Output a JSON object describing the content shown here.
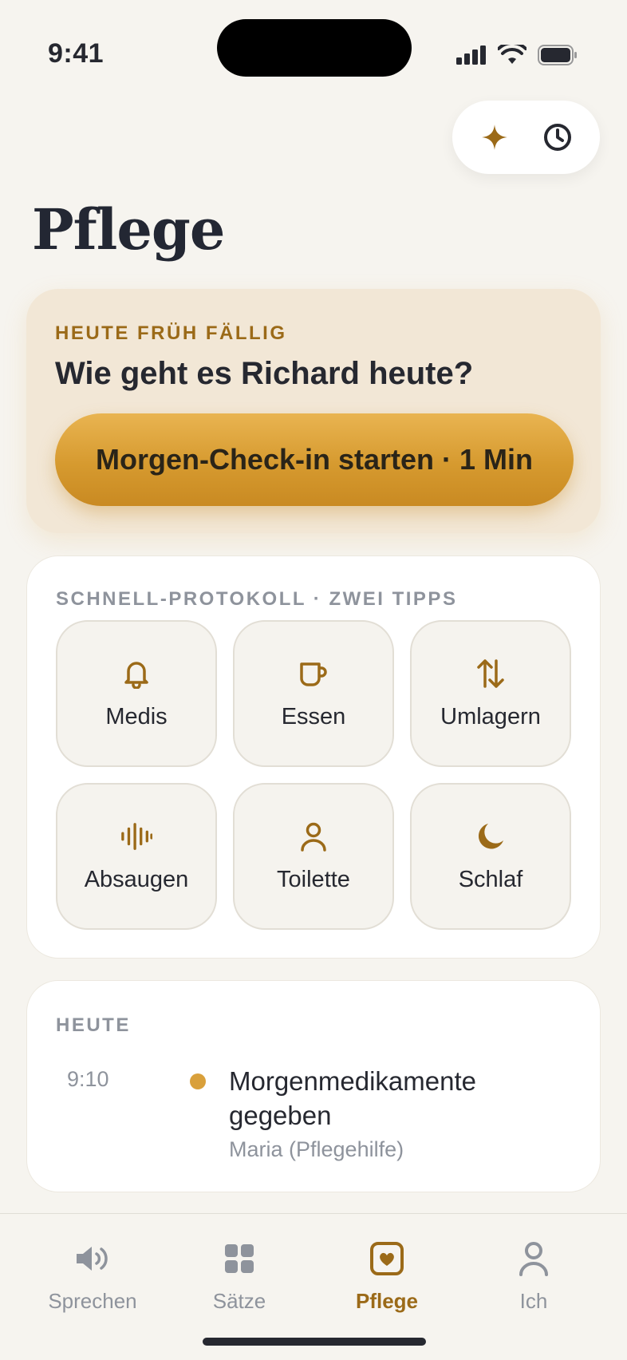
{
  "status_bar": {
    "time": "9:41"
  },
  "top_actions": {
    "sparkle_icon": "sparkle-icon",
    "history_icon": "clock-icon"
  },
  "page": {
    "title": "Pflege"
  },
  "checkin": {
    "eyebrow": "HEUTE FRÜH FÄLLIG",
    "question": "Wie geht es Richard heute?",
    "button_label": "Morgen-Check-in starten · 1 Min"
  },
  "quick_log": {
    "label": "SCHNELL-PROTOKOLL · ZWEI TIPPS",
    "tiles": [
      {
        "label": "Medis",
        "icon": "bell-icon"
      },
      {
        "label": "Essen",
        "icon": "cup-icon"
      },
      {
        "label": "Umlagern",
        "icon": "swap-icon"
      },
      {
        "label": "Absaugen",
        "icon": "waveform-icon"
      },
      {
        "label": "Toilette",
        "icon": "person-icon"
      },
      {
        "label": "Schlaf",
        "icon": "moon-icon"
      }
    ]
  },
  "today": {
    "label": "HEUTE",
    "entries": [
      {
        "time": "9:10",
        "title": "Morgenmedikamente gegeben",
        "subtitle": "Maria (Pflegehilfe)"
      }
    ]
  },
  "tab_bar": {
    "tabs": [
      {
        "label": "Sprechen",
        "icon": "speaker-icon",
        "active": false
      },
      {
        "label": "Sätze",
        "icon": "grid-icon",
        "active": false
      },
      {
        "label": "Pflege",
        "icon": "heart-square-icon",
        "active": true
      },
      {
        "label": "Ich",
        "icon": "person-icon",
        "active": false
      }
    ]
  },
  "colors": {
    "accent": "#9b6a18",
    "accent_button": "#d69a2f",
    "background": "#f6f4ef",
    "muted_text": "#8e939c",
    "dot": "#d9a03b"
  }
}
